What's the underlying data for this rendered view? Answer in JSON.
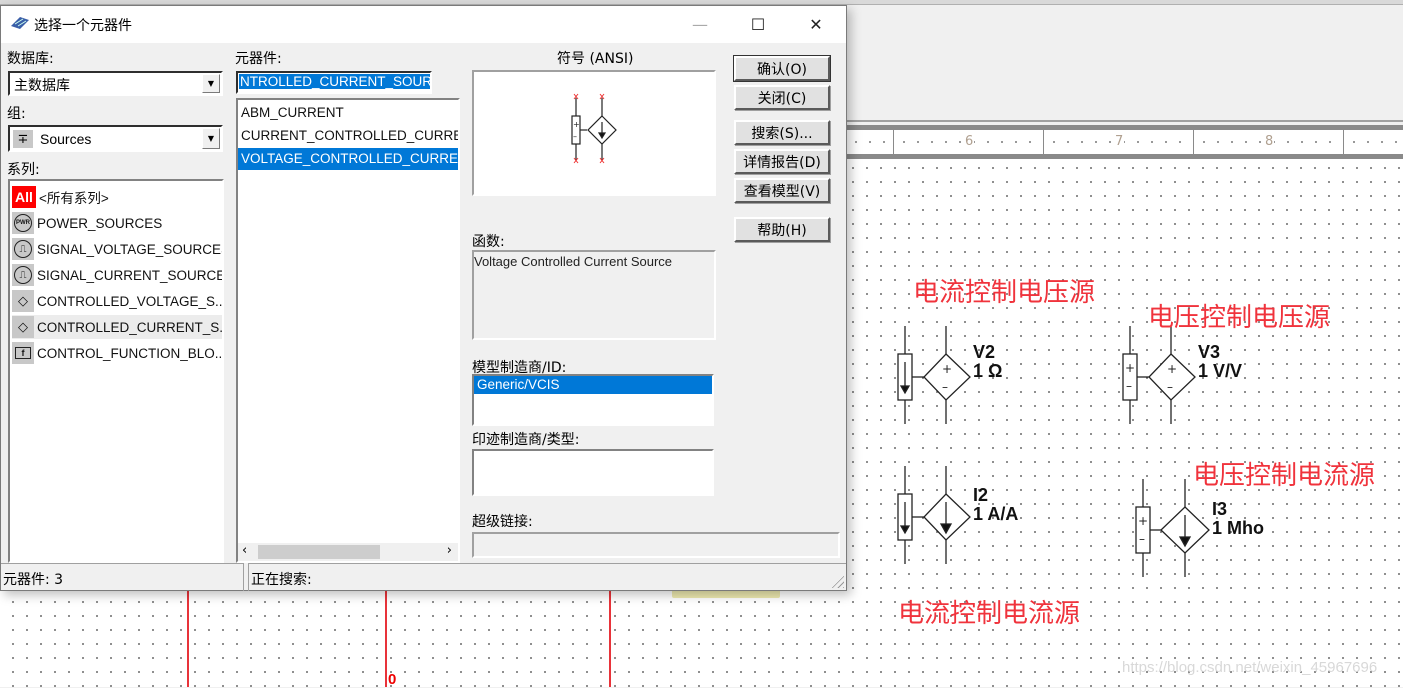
{
  "background": {
    "ruler_labels": [
      "6",
      "7",
      "8"
    ],
    "node_label": "0",
    "annotations": {
      "ccvs": "电流控制电压源",
      "vcvs": "电压控制电压源",
      "cccs": "电流控制电流源",
      "vccs": "电压控制电流源"
    },
    "components": [
      {
        "ref": "V2",
        "value": "1 Ω"
      },
      {
        "ref": "V3",
        "value": "1 V/V"
      },
      {
        "ref": "I2",
        "value": "1 A/A"
      },
      {
        "ref": "I3",
        "value": "1 Mho"
      }
    ],
    "watermark": "https://blog.csdn.net/weixin_45967696"
  },
  "dialog": {
    "title": "选择一个元器件",
    "window_buttons": {
      "minimize": "—",
      "maximize": "☐",
      "close": "✕"
    },
    "database": {
      "label": "数据库:",
      "value": "主数据库"
    },
    "group": {
      "label": "组:",
      "value": "Sources",
      "icon": "ground-source-icon"
    },
    "series": {
      "label": "系列:",
      "items": [
        {
          "label": "<所有系列>",
          "icon": "All"
        },
        {
          "label": "POWER_SOURCES",
          "icon": "PWR"
        },
        {
          "label": "SIGNAL_VOLTAGE_SOURCES",
          "icon": "⎍"
        },
        {
          "label": "SIGNAL_CURRENT_SOURCES",
          "icon": "⎍"
        },
        {
          "label": "CONTROLLED_VOLTAGE_S...",
          "icon": "◇"
        },
        {
          "label": "CONTROLLED_CURRENT_S...",
          "icon": "◇"
        },
        {
          "label": "CONTROL_FUNCTION_BLO...",
          "icon": "f"
        }
      ],
      "selected_index": 5
    },
    "component": {
      "label": "元器件:",
      "search_value": "NTROLLED_CURRENT_SOURCE",
      "items": [
        "ABM_CURRENT",
        "CURRENT_CONTROLLED_CURRENT_SOURCE",
        "VOLTAGE_CONTROLLED_CURRENT_SOURCE"
      ],
      "selected_index": 2
    },
    "symbol": {
      "label": "符号 (ANSI)"
    },
    "function": {
      "label": "函数:",
      "value": "Voltage Controlled Current Source"
    },
    "model": {
      "label": "模型制造商/ID:",
      "items": [
        "Generic/VCIS"
      ],
      "selected_index": 0
    },
    "footprint": {
      "label": "印迹制造商/类型:",
      "items": []
    },
    "hyperlink": {
      "label": "超级链接:",
      "value": ""
    },
    "buttons": {
      "ok": "确认(O)",
      "close": "关闭(C)",
      "search": "搜索(S)...",
      "detail_report": "详情报告(D)",
      "view_model": "查看模型(V)",
      "help": "帮助(H)"
    },
    "status": {
      "component_count_label": "元器件:",
      "component_count": "3",
      "searching_label": "正在搜索:"
    }
  }
}
